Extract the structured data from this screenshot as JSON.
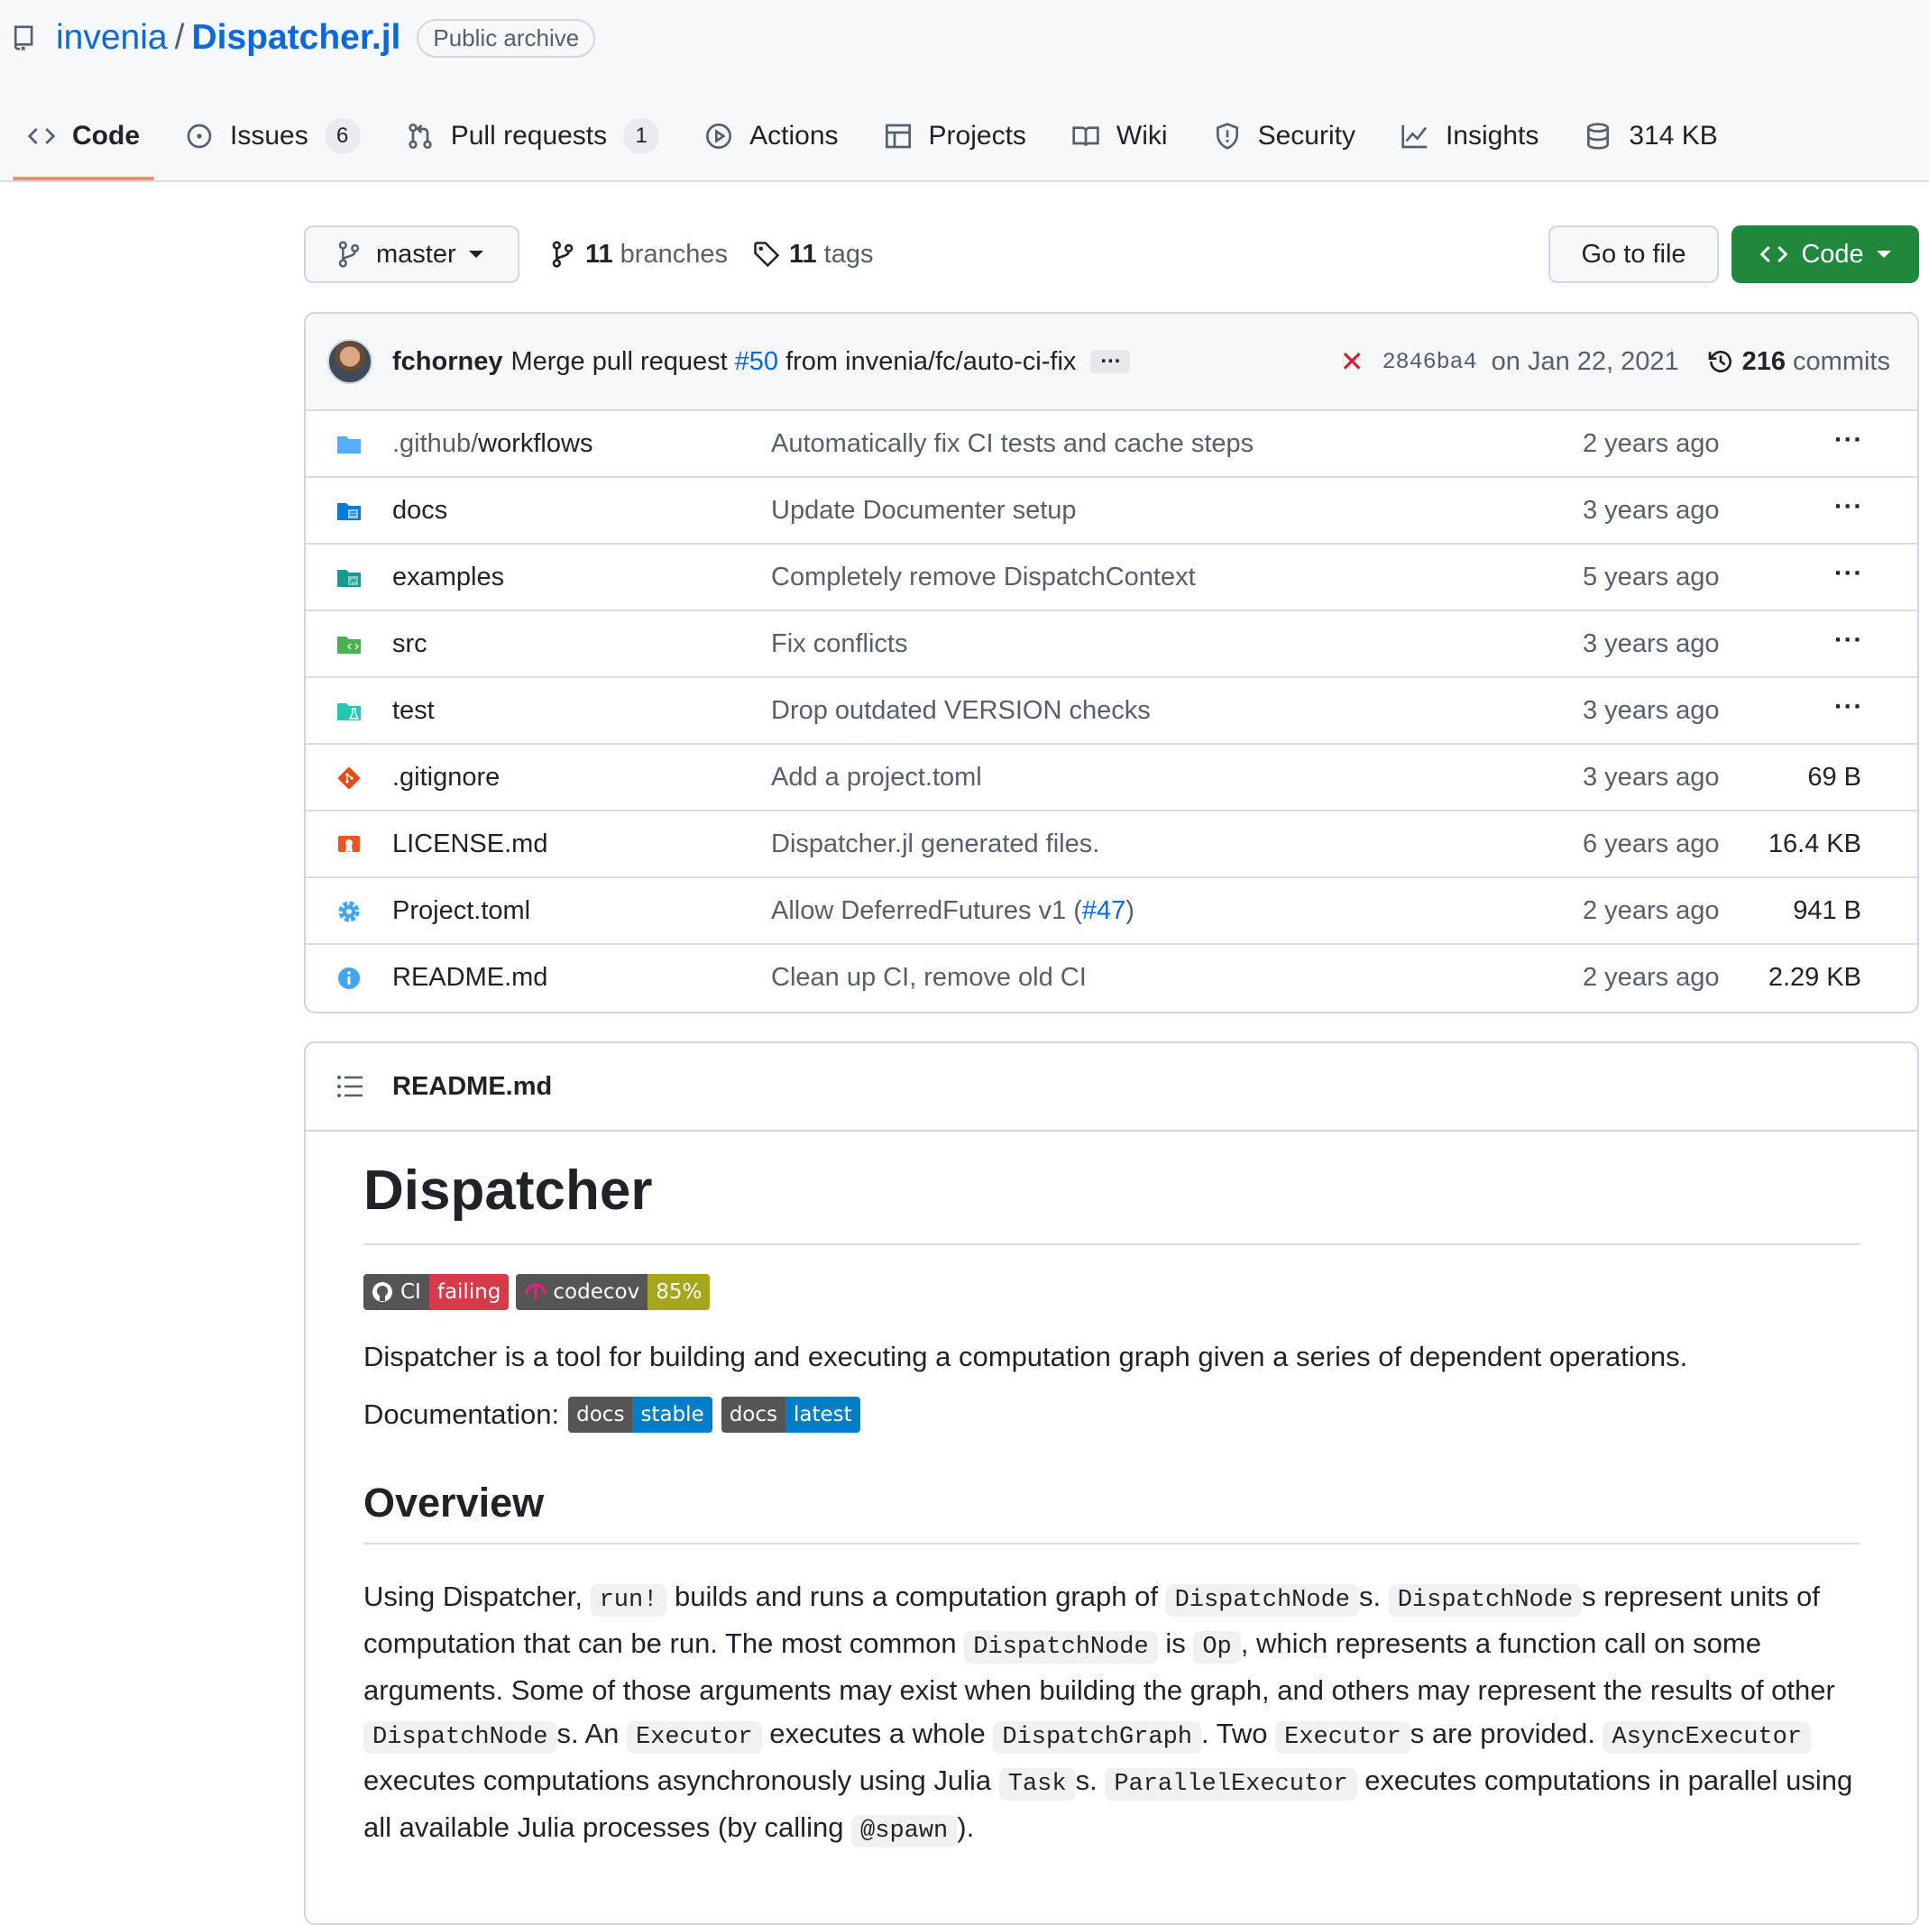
{
  "repo": {
    "owner": "invenia",
    "slash": "/",
    "name": "Dispatcher.jl",
    "label": "Public archive"
  },
  "tabs": [
    {
      "label": "Code",
      "icon": "code-icon",
      "active": true
    },
    {
      "label": "Issues",
      "icon": "issue-icon",
      "count": "6"
    },
    {
      "label": "Pull requests",
      "icon": "pull-request-icon",
      "count": "1"
    },
    {
      "label": "Actions",
      "icon": "play-icon"
    },
    {
      "label": "Projects",
      "icon": "table-icon"
    },
    {
      "label": "Wiki",
      "icon": "book-icon"
    },
    {
      "label": "Security",
      "icon": "shield-icon"
    },
    {
      "label": "Insights",
      "icon": "graph-icon"
    },
    {
      "label": "314 KB",
      "icon": "database-icon"
    }
  ],
  "toolbar": {
    "branch": "master",
    "branches_count": "11",
    "branches_label": "branches",
    "tags_count": "11",
    "tags_label": "tags",
    "go_to_file": "Go to file",
    "code_button": "Code"
  },
  "commit": {
    "author": "fchorney",
    "message_prefix": "Merge pull request",
    "pr": "#50",
    "message_suffix": "from invenia/fc/auto-ci-fix",
    "more": "…",
    "status": "✕",
    "sha": "2846ba4",
    "date": "on Jan 22, 2021",
    "commits_count": "216",
    "commits_label": "commits"
  },
  "files": [
    {
      "name_dim": ".github/",
      "name": "workflows",
      "message": "Automatically fix CI tests and cache steps",
      "age": "2 years ago",
      "size": "",
      "icon": "folder-icon",
      "color": "#54aeff"
    },
    {
      "name_dim": "",
      "name": "docs",
      "message": "Update Documenter setup",
      "age": "3 years ago",
      "size": "",
      "icon": "docs-folder-icon",
      "color": "#0b7ad6"
    },
    {
      "name_dim": "",
      "name": "examples",
      "message": "Completely remove DispatchContext",
      "age": "5 years ago",
      "size": "",
      "icon": "examples-folder-icon",
      "color": "#1a9a8f"
    },
    {
      "name_dim": "",
      "name": "src",
      "message": "Fix conflicts",
      "age": "3 years ago",
      "size": "",
      "icon": "src-folder-icon",
      "color": "#4caf50"
    },
    {
      "name_dim": "",
      "name": "test",
      "message": "Drop outdated VERSION checks",
      "age": "3 years ago",
      "size": "",
      "icon": "test-folder-icon",
      "color": "#26c6b5"
    },
    {
      "name_dim": "",
      "name": ".gitignore",
      "message": "Add a project.toml",
      "age": "3 years ago",
      "size": "69 B",
      "icon": "git-icon",
      "color": "#e64a19"
    },
    {
      "name_dim": "",
      "name": "LICENSE.md",
      "message": "Dispatcher.jl generated files.",
      "age": "6 years ago",
      "size": "16.4 KB",
      "icon": "license-icon",
      "color": "#f4511e"
    },
    {
      "name_dim": "",
      "name": "Project.toml",
      "message": "Allow DeferredFutures v1 (",
      "message_pr": "#47",
      "message_end": ")",
      "age": "2 years ago",
      "size": "941 B",
      "icon": "gear-icon",
      "color": "#42a5f5"
    },
    {
      "name_dim": "",
      "name": "README.md",
      "message": "Clean up CI, remove old CI",
      "age": "2 years ago",
      "size": "2.29 KB",
      "icon": "info-icon",
      "color": "#42a5f5"
    }
  ],
  "more_label": "···",
  "readme": {
    "file": "README.md",
    "title": "Dispatcher",
    "badges": [
      {
        "left": "CI",
        "right": "failing",
        "color": "#d73a49",
        "icon": "github-icon"
      },
      {
        "left": "codecov",
        "right": "85%",
        "color": "#a4a61d",
        "icon": "codecov-icon"
      }
    ],
    "intro": "Dispatcher is a tool for building and executing a computation graph given a series of dependent operations.",
    "doc_label": "Documentation:",
    "doc_badges": [
      {
        "left": "docs",
        "right": "stable",
        "color": "#007ec6"
      },
      {
        "left": "docs",
        "right": "latest",
        "color": "#007ec6"
      }
    ],
    "overview_title": "Overview",
    "overview": [
      {
        "t": "Using Dispatcher, "
      },
      {
        "c": "run!"
      },
      {
        "t": " builds and runs a computation graph of "
      },
      {
        "c": "DispatchNode"
      },
      {
        "t": "s. "
      },
      {
        "c": "DispatchNode"
      },
      {
        "t": "s represent units of computation that can be run. The most common "
      },
      {
        "c": "DispatchNode"
      },
      {
        "t": " is "
      },
      {
        "c": "Op"
      },
      {
        "t": ", which represents a function call on some arguments. Some of those arguments may exist when building the graph, and others may represent the results of other "
      },
      {
        "c": "DispatchNode"
      },
      {
        "t": "s. An "
      },
      {
        "c": "Executor"
      },
      {
        "t": " executes a whole "
      },
      {
        "c": "DispatchGraph"
      },
      {
        "t": ". Two "
      },
      {
        "c": "Executor"
      },
      {
        "t": "s are provided. "
      },
      {
        "c": "AsyncExecutor"
      },
      {
        "t": " executes computations asynchronously using Julia "
      },
      {
        "c": "Task"
      },
      {
        "t": "s. "
      },
      {
        "c": "ParallelExecutor"
      },
      {
        "t": " executes computations in parallel using all available Julia processes (by calling "
      },
      {
        "c": "@spawn"
      },
      {
        "t": ")."
      }
    ]
  },
  "colors": {
    "link": "#0969da",
    "primary_button": "#1f883d",
    "tab_underline": "#fd8c73",
    "error": "#cf222e"
  }
}
